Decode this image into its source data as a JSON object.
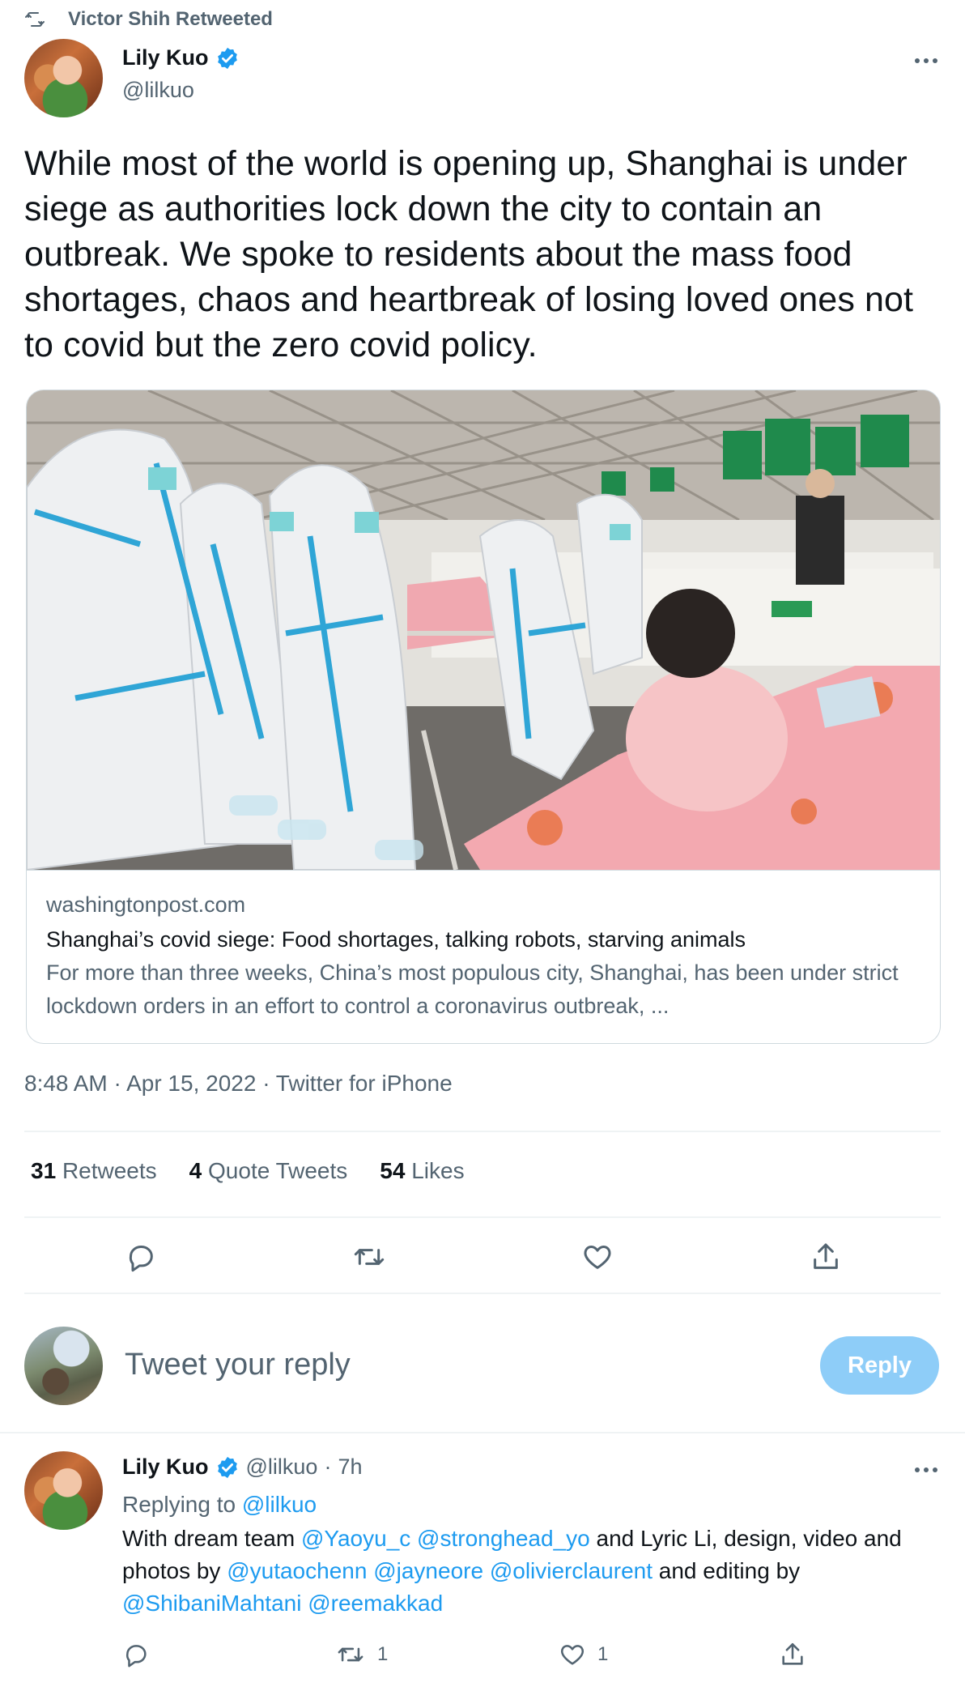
{
  "retweet_header": {
    "label": "Victor Shih Retweeted",
    "icon": "retweet-icon"
  },
  "main_tweet": {
    "author_name": "Lily Kuo",
    "author_handle": "@lilkuo",
    "verified": true,
    "text": "While most of the world is opening up, Shanghai is under siege as authorities lock down the city to contain an outbreak. We spoke to residents about the mass food shortages, chaos and heartbreak of losing loved ones not to covid but the zero covid policy.",
    "card": {
      "domain": "washingtonpost.com",
      "title": "Shanghai’s covid siege: Food shortages, talking robots, starving animals",
      "description": "For more than three weeks, China’s most populous city, Shanghai, has been under strict lockdown orders in an effort to control a coronavirus outbreak, ..."
    },
    "timestamp": "8:48 AM · Apr 15, 2022 · Twitter for iPhone",
    "stats": [
      {
        "count": "31",
        "label": "Retweets"
      },
      {
        "count": "4",
        "label": "Quote Tweets"
      },
      {
        "count": "54",
        "label": "Likes"
      }
    ]
  },
  "reply_box": {
    "placeholder": "Tweet your reply",
    "button_label": "Reply"
  },
  "reply_tweet": {
    "author_name": "Lily Kuo",
    "author_handle": "@lilkuo",
    "separator": "·",
    "time": "7h",
    "replying_prefix": "Replying to",
    "replying_to": "@lilkuo",
    "text_parts": {
      "p1": "With dream team ",
      "m1": "@Yaoyu_c",
      "s1": " ",
      "m2": "@stronghead_yo",
      "p2": " and Lyric Li, design, video and photos by ",
      "m3": "@yutaochenn",
      "s2": " ",
      "m4": "@jayneore",
      "s3": " ",
      "m5": "@olivierclaurent",
      "p3": " and editing by ",
      "m6": "@ShibaniMahtani",
      "s4": " ",
      "m7": "@reemakkad"
    },
    "actions": {
      "reply_count": "",
      "retweet_count": "1",
      "like_count": "1"
    }
  },
  "colors": {
    "accent": "#1d9bf0",
    "muted": "#536471",
    "reply_button_disabled": "#8ecdf8"
  }
}
